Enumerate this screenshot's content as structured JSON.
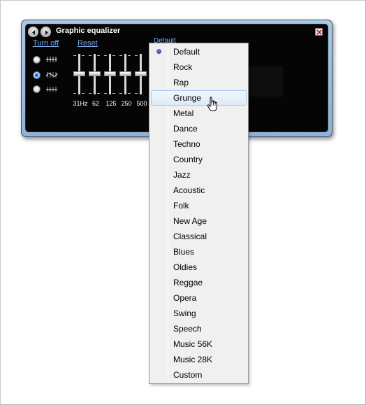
{
  "window": {
    "title": "Graphic equalizer",
    "turn_off_label": "Turn off",
    "reset_label": "Reset",
    "preset_partial": "Default"
  },
  "bands": {
    "labels": [
      "31Hz",
      "62",
      "125",
      "250",
      "500"
    ]
  },
  "preset_menu": {
    "selected": "Default",
    "hovered": "Grunge",
    "items": [
      "Default",
      "Rock",
      "Rap",
      "Grunge",
      "Metal",
      "Dance",
      "Techno",
      "Country",
      "Jazz",
      "Acoustic",
      "Folk",
      "New Age",
      "Classical",
      "Blues",
      "Oldies",
      "Reggae",
      "Opera",
      "Swing",
      "Speech",
      "Music 56K",
      "Music 28K",
      "Custom"
    ]
  },
  "colors": {
    "window_frame": "#9fc0e2",
    "panel_bg": "#050505",
    "link": "#7ea9e8",
    "menu_bg": "#f0f0f0",
    "menu_hover": "#dde9f7",
    "bullet": "#1d2a8f"
  },
  "icons": {
    "back": "back-arrow-icon",
    "forward": "forward-arrow-icon",
    "close": "close-icon",
    "cursor": "hand-pointer-icon"
  }
}
